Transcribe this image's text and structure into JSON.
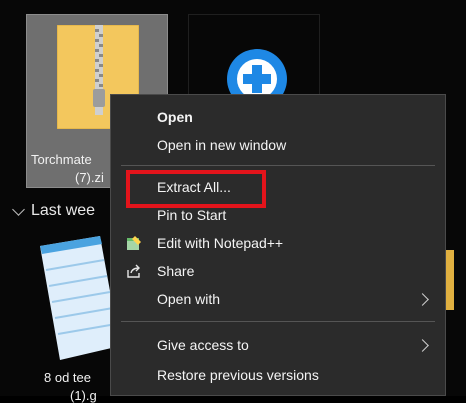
{
  "files": {
    "selected_zip": {
      "name_line1": "Torchmate",
      "name_line2": "(7).zi",
      "icon": "zip-folder-icon"
    },
    "exe": {
      "icon": "installer-plus-icon"
    }
  },
  "group": {
    "label": "Last wee"
  },
  "notepad_file": {
    "name_line1": "8 od tee",
    "name_line2": "(1).g",
    "icon": "notepad-document-icon"
  },
  "context_menu": {
    "items": [
      {
        "label": "Open",
        "bold": true
      },
      {
        "label": "Open in new window"
      },
      {
        "label": "Extract All..."
      },
      {
        "label": "Pin to Start"
      },
      {
        "label": "Edit with Notepad++",
        "icon": "notepad-plus-plus-icon"
      },
      {
        "label": "Share",
        "icon": "share-icon"
      },
      {
        "label": "Open with",
        "has_submenu": true
      },
      {
        "label": "Give access to",
        "has_submenu": true
      },
      {
        "label": "Restore previous versions"
      }
    ]
  },
  "colors": {
    "highlight": "#e3141b",
    "menu_bg": "#2b2b2b",
    "selection_bg": "#6f6f6f"
  }
}
